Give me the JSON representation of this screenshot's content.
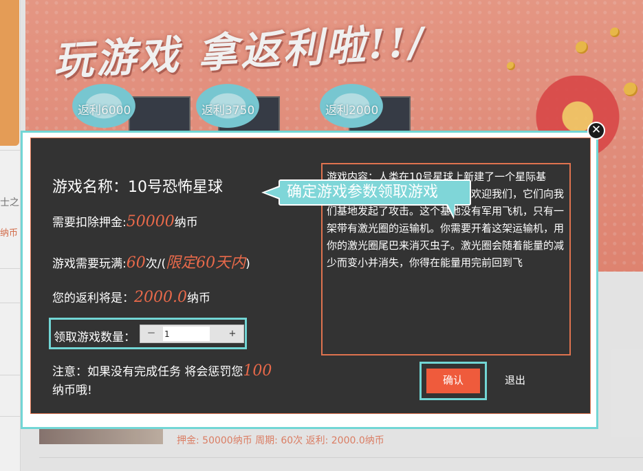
{
  "background": {
    "banner_title": "玩游戏 拿返利啦!!/",
    "badges": [
      "返利6000",
      "返利3750",
      "返利2000"
    ],
    "side_text": "士之",
    "side_text2": "纳币",
    "list_item_meta": "押金: 50000纳币 周期: 60次 返利: 2000.0纳币"
  },
  "dialog": {
    "close_symbol": "✕",
    "game_name_label": "游戏名称：",
    "game_name": "10号恐怖星球",
    "deposit_label": "需要扣除押金:",
    "deposit_value": "50000",
    "deposit_unit": "纳币",
    "plays_label": "游戏需要玩满:",
    "plays_value": "60",
    "plays_unit": "次/(",
    "plays_limit": "限定60天内",
    "plays_close": ")",
    "rebate_label": "您的返利将是：",
    "rebate_value": "2000.0",
    "rebate_unit": "纳币",
    "quantity_label": "领取游戏数量：",
    "quantity_minus": "－",
    "quantity_value": "1",
    "quantity_plus": "+",
    "note_prefix": "注意：如果没有完成任务 将会惩罚您",
    "note_value": "100",
    "note_suffix": "纳币哦!",
    "callout_text": "确定游戏参数领取游戏",
    "description": "游戏内容：人类在10号星球上新建了一个星际基地。但是这个星球上的虫族却不欢迎我们，它们向我们基地发起了攻击。这个基地没有军用飞机，只有一架带有激光圈的运输机。你需要开着这架运输机，用你的激光圈尾巴来消灭虫子。激光圈会随着能量的减少而变小并消失，你得在能量用完前回到飞",
    "confirm_label": "确认",
    "exit_label": "退出"
  },
  "colors": {
    "highlight": "#e8694a",
    "accent_teal": "#72d6d5",
    "confirm_bg": "#ef5b3c",
    "dialog_bg": "#333333"
  }
}
